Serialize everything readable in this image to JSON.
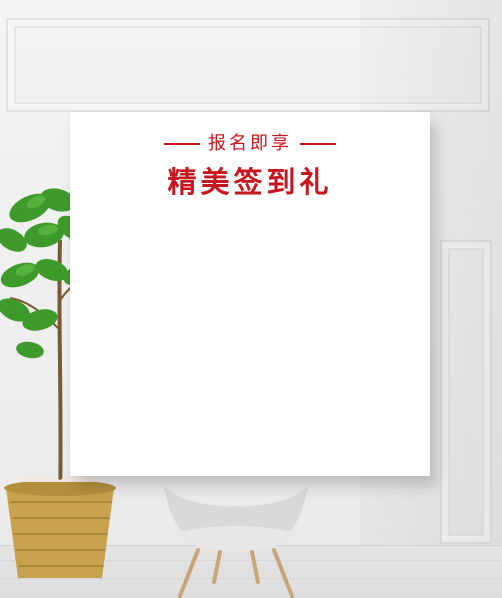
{
  "board": {
    "headline": "报名即享",
    "title": "精美签到礼"
  },
  "colors": {
    "accent": "#c8161e",
    "board": "#ffffff",
    "wall": "#f1f1f1",
    "leaf": "#3f9a2c",
    "basket": "#c8a24e"
  }
}
